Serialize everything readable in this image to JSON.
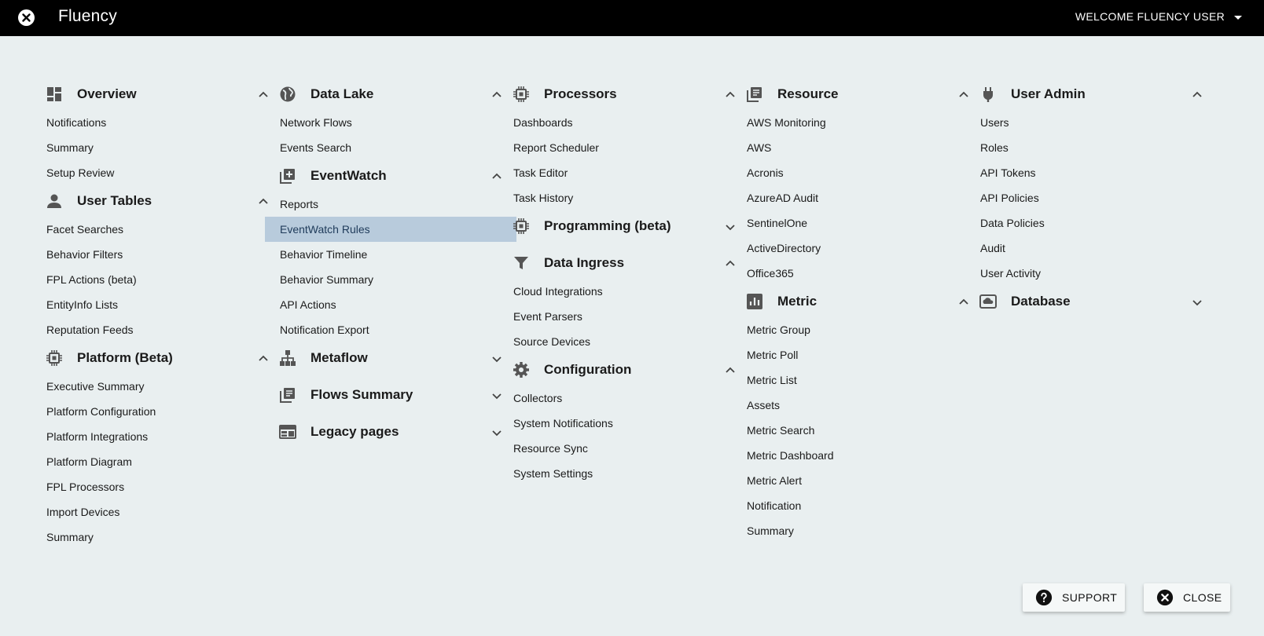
{
  "header": {
    "app_title": "Fluency",
    "welcome": "WELCOME FLUENCY USER"
  },
  "columns": [
    {
      "sections": [
        {
          "title": "Overview",
          "icon": "dashboard-icon",
          "expanded": true,
          "items": [
            "Notifications",
            "Summary",
            "Setup Review"
          ]
        },
        {
          "title": "User Tables",
          "icon": "person-icon",
          "expanded": true,
          "items": [
            "Facet Searches",
            "Behavior Filters",
            "FPL Actions (beta)",
            "EntityInfo Lists",
            "Reputation Feeds"
          ]
        },
        {
          "title": "Platform (Beta)",
          "icon": "chip-icon",
          "expanded": true,
          "items": [
            "Executive Summary",
            "Platform Configuration",
            "Platform Integrations",
            "Platform Diagram",
            "FPL Processors",
            "Import Devices",
            "Summary"
          ]
        }
      ]
    },
    {
      "sections": [
        {
          "title": "Data Lake",
          "icon": "globe-icon",
          "expanded": true,
          "items": [
            "Network Flows",
            "Events Search"
          ]
        },
        {
          "title": "EventWatch",
          "icon": "library-add-icon",
          "expanded": true,
          "items": [
            "Reports",
            "EventWatch Rules",
            "Behavior Timeline",
            "Behavior Summary",
            "API Actions",
            "Notification Export"
          ],
          "active_item": "EventWatch Rules"
        },
        {
          "title": "Metaflow",
          "icon": "hierarchy-icon",
          "expanded": false,
          "items": []
        },
        {
          "title": "Flows Summary",
          "icon": "library-books-icon",
          "expanded": false,
          "items": []
        },
        {
          "title": "Legacy pages",
          "icon": "web-icon",
          "expanded": false,
          "items": []
        }
      ]
    },
    {
      "sections": [
        {
          "title": "Processors",
          "icon": "chip-icon",
          "expanded": true,
          "items": [
            "Dashboards",
            "Report Scheduler",
            "Task Editor",
            "Task History"
          ]
        },
        {
          "title": "Programming (beta)",
          "icon": "chip-icon",
          "expanded": false,
          "items": []
        },
        {
          "title": "Data Ingress",
          "icon": "filter-icon",
          "expanded": true,
          "items": [
            "Cloud Integrations",
            "Event Parsers",
            "Source Devices"
          ]
        },
        {
          "title": "Configuration",
          "icon": "gear-icon",
          "expanded": true,
          "items": [
            "Collectors",
            "System Notifications",
            "Resource Sync",
            "System Settings"
          ]
        }
      ]
    },
    {
      "sections": [
        {
          "title": "Resource",
          "icon": "library-books-icon",
          "expanded": true,
          "items": [
            "AWS Monitoring",
            "AWS",
            "Acronis",
            "AzureAD Audit",
            "SentinelOne",
            "ActiveDirectory",
            "Office365"
          ]
        },
        {
          "title": "Metric",
          "icon": "bar-chart-icon",
          "expanded": true,
          "items": [
            "Metric Group",
            "Metric Poll",
            "Metric List",
            "Assets",
            "Metric Search",
            "Metric Dashboard",
            "Metric Alert",
            "Notification",
            "Summary"
          ]
        }
      ]
    },
    {
      "sections": [
        {
          "title": "User Admin",
          "icon": "plug-icon",
          "expanded": true,
          "items": [
            "Users",
            "Roles",
            "API Tokens",
            "API Policies",
            "Data Policies",
            "Audit",
            "User Activity"
          ]
        },
        {
          "title": "Database",
          "icon": "cloud-box-icon",
          "expanded": false,
          "items": []
        }
      ]
    }
  ],
  "buttons": {
    "support": "SUPPORT",
    "close": "CLOSE"
  }
}
